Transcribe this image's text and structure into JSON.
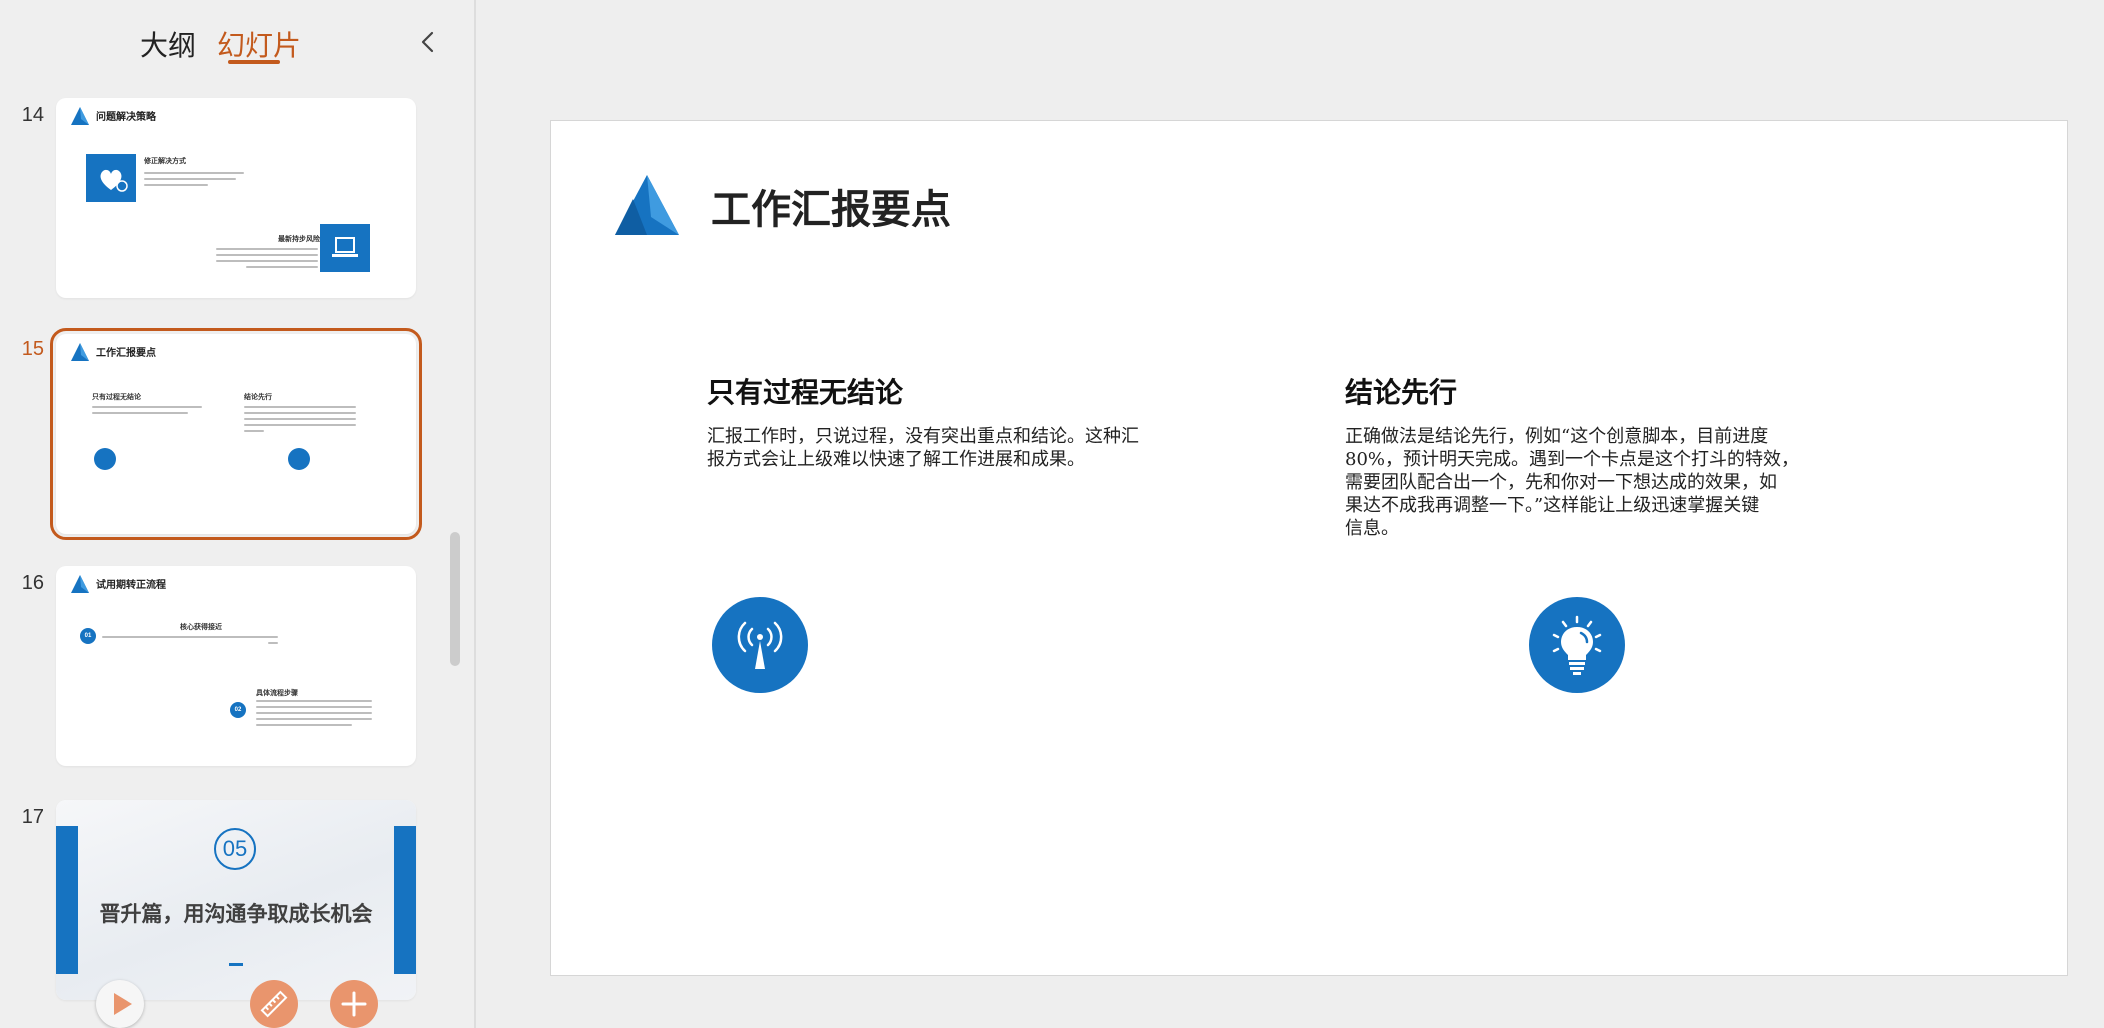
{
  "panel": {
    "tab_outline": "大纲",
    "tab_slides": "幻灯片"
  },
  "thumbnails": [
    {
      "number": "14",
      "title": "问题解决策略",
      "item1_heading": "修正解决方式",
      "item2_heading": "最新持步风险"
    },
    {
      "number": "15",
      "title": "工作汇报要点",
      "left_heading": "只有过程无结论",
      "right_heading": "结论先行"
    },
    {
      "number": "16",
      "title": "试用期转正流程",
      "badge1": "01",
      "heading1": "核心获得接近",
      "badge2": "02",
      "heading2": "具体流程步骤"
    },
    {
      "number": "17",
      "section_number": "05",
      "title": "晋升篇，用沟通争取成长机会"
    }
  ],
  "slide": {
    "title": "工作汇报要点",
    "left": {
      "heading": "只有过程无结论",
      "lines": [
        "汇报工作时，只说过程，没有突出重点和结论。这种汇",
        "报方式会让上级难以快速了解工作进展和成果。"
      ],
      "icon": "broadcast-icon"
    },
    "right": {
      "heading": "结论先行",
      "lines": [
        "正确做法是结论先行，例如“这个创意脚本，目前进度",
        "80%，预计明天完成。遇到一个卡点是这个打斗的特效，",
        "需要团队配合出一个，先和你对一下想达成的效果，如",
        "果达不成我再调整一下。”这样能让上级迅速掌握关键",
        "信息。"
      ],
      "icon": "lightbulb-icon"
    }
  },
  "colors": {
    "accent": "#c35a1d",
    "brand_blue": "#1673c1",
    "fab_orange": "#e9956d"
  }
}
